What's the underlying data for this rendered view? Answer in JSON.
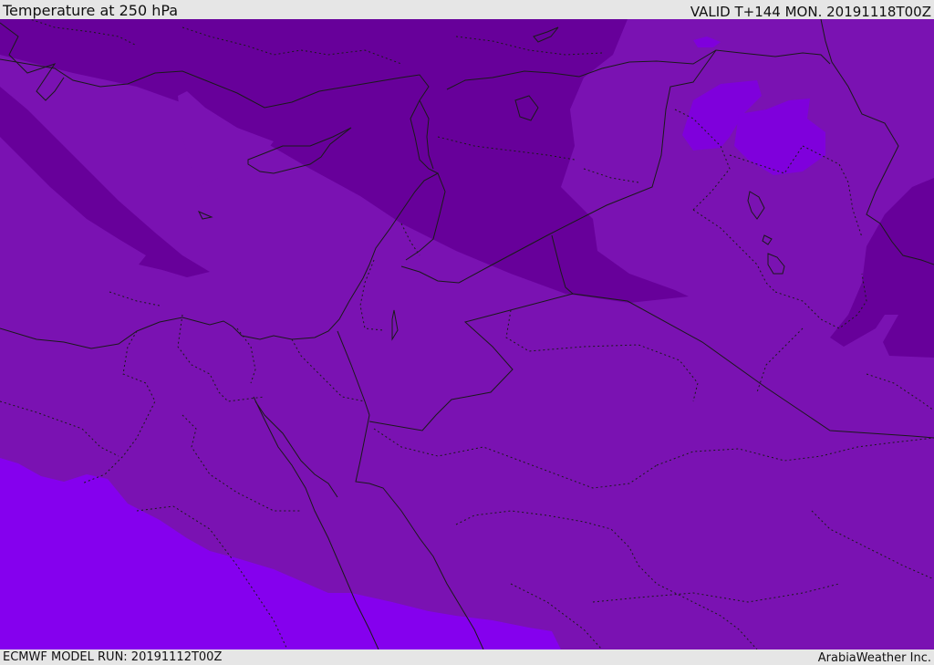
{
  "header": {
    "title": "Temperature at 250 hPa",
    "valid": "VALID T+144 MON. 20191118T00Z"
  },
  "footer": {
    "model_run": "ECMWF MODEL RUN: 20191112T00Z",
    "credit": "ArabiaWeather Inc."
  },
  "colors": {
    "band_cold_dark": "#67009a",
    "band_mid": "#7a12b2",
    "band_warm": "#7f00dc",
    "band_warm_light": "#8500ee",
    "lines": "#1a1a1a",
    "frame": "#e6e6e6"
  }
}
